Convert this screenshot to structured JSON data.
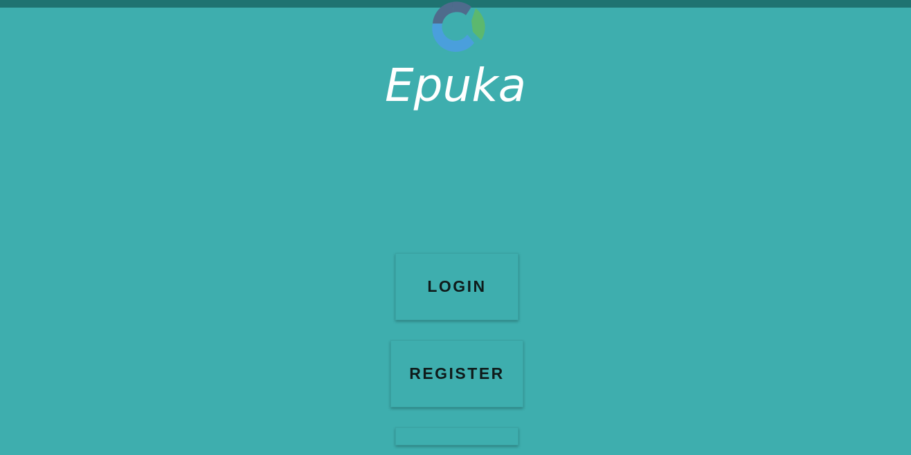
{
  "app": {
    "title": "Epuka"
  },
  "buttons": {
    "login_label": "LOGIN",
    "register_label": "REGISTER",
    "third_label": ""
  },
  "colors": {
    "background": "#3eaeae",
    "status_bar": "#1f7371",
    "logo_dark": "#4f6b8c",
    "logo_blue": "#4a9fdc",
    "logo_green": "#5cb86e",
    "title_text": "#ffffff",
    "button_text": "#0f1b1b"
  },
  "icons": {
    "logo": "epuka-logo-icon"
  }
}
